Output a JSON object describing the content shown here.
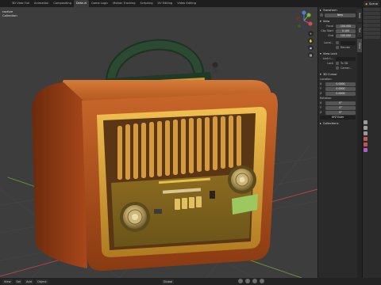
{
  "topbar": {
    "tabs": [
      {
        "label": "3D View Full"
      },
      {
        "label": "Animation"
      },
      {
        "label": "Compositing"
      },
      {
        "label": "Default",
        "active": true
      },
      {
        "label": "Game Logic"
      },
      {
        "label": "Motion Tracking"
      },
      {
        "label": "Scripting"
      },
      {
        "label": "UV Editing"
      },
      {
        "label": "Video Editing"
      }
    ],
    "scene_label": "Scene"
  },
  "viewport": {
    "overlay_line1": "ractive",
    "overlay_line2": "Collection"
  },
  "npanel": {
    "transform_label": "Transform",
    "new_label": "New",
    "view_label": "View",
    "focal_label": "Focal",
    "focal_value": "100.000",
    "clip_start_label": "Clip Start",
    "clip_start_value": "0.100",
    "clip_end_label": "End",
    "clip_end_value": "100.000",
    "local_camera_label": "Local...",
    "render_label": "Render",
    "view_lock_label": "View Lock",
    "lock_to_label": "Lock t...",
    "lock_label": "Lock",
    "to_3d_label": "To 3D",
    "camera_label": "Camer...",
    "cursor_label": "3D Cursor",
    "location_label": "Location:",
    "loc_x": "0.0000",
    "loc_y": "0.0000",
    "loc_z": "0.0000",
    "rotation_label": "Rotation:",
    "rot_x": "0°",
    "rot_y": "0°",
    "rot_z": "0°",
    "rotation_mode": "XYZ Euler",
    "collections_label": "Collections"
  },
  "side_tabs": [
    "Item",
    "Tool",
    "View"
  ],
  "statusbar": {
    "view_label": "View",
    "select_label": "Sel",
    "add_label": "Add",
    "object_label": "Object",
    "mode_label": "Global"
  },
  "colors": {
    "viewport_bg": "#3d3d3d",
    "accent": "#4772b3",
    "grid_red": "#b8474f",
    "grid_green": "#6d9a3a",
    "radio_wood": "#b5521b",
    "radio_gold": "#d9a33a",
    "handle_green": "#2c4a32"
  },
  "icons": [
    "view-gizmo",
    "zoom-icon",
    "hand-icon",
    "camera-icon",
    "grid-icon"
  ]
}
